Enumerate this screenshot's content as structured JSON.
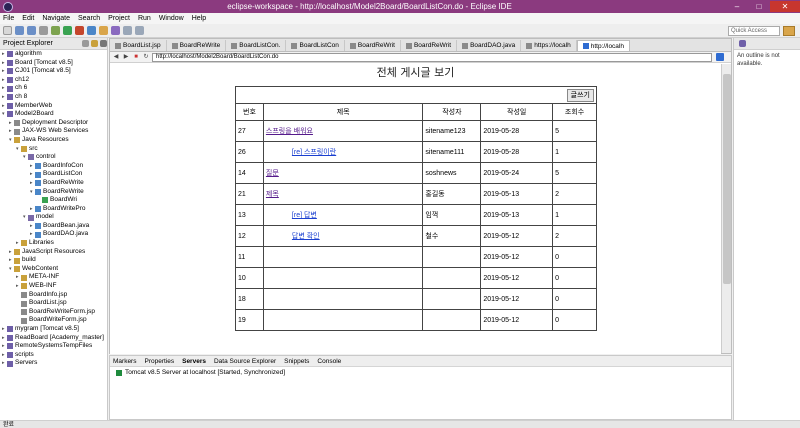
{
  "window": {
    "title": "eclipse-workspace - http://localhost/Model2Board/BoardListCon.do - Eclipse IDE",
    "min": "–",
    "max": "□",
    "close": "✕"
  },
  "menu": [
    "File",
    "Edit",
    "Navigate",
    "Search",
    "Project",
    "Run",
    "Window",
    "Help"
  ],
  "toolbar": {
    "quick_access": "Quick Access"
  },
  "explorer": {
    "title": "Project Explorer",
    "items": [
      {
        "label": "algorithm",
        "level": 0,
        "arrow": "▸",
        "color": "#6e5fa8"
      },
      {
        "label": "Board [Tomcat v8.5]",
        "level": 0,
        "arrow": "▸",
        "color": "#6e5fa8"
      },
      {
        "label": "CJ01 [Tomcat v8.5]",
        "level": 0,
        "arrow": "▸",
        "color": "#6e5fa8"
      },
      {
        "label": "ch12",
        "level": 0,
        "arrow": "▸",
        "color": "#6e5fa8"
      },
      {
        "label": "ch 6",
        "level": 0,
        "arrow": "▸",
        "color": "#6e5fa8"
      },
      {
        "label": "ch 8",
        "level": 0,
        "arrow": "▸",
        "color": "#6e5fa8"
      },
      {
        "label": "MemberWeb",
        "level": 0,
        "arrow": "▸",
        "color": "#6e5fa8"
      },
      {
        "label": "Model2Board",
        "level": 0,
        "arrow": "▾",
        "color": "#6e5fa8"
      },
      {
        "label": "Deployment Descriptor",
        "level": 1,
        "arrow": "▸",
        "color": "#8a8a8a"
      },
      {
        "label": "JAX-WS Web Services",
        "level": 1,
        "arrow": "▸",
        "color": "#8a8a8a"
      },
      {
        "label": "Java Resources",
        "level": 1,
        "arrow": "▾",
        "color": "#c9a13b"
      },
      {
        "label": "src",
        "level": 2,
        "arrow": "▾",
        "color": "#c9a13b"
      },
      {
        "label": "control",
        "level": 3,
        "arrow": "▾",
        "color": "#7a6aa8"
      },
      {
        "label": "BoardInfoCon",
        "level": 4,
        "arrow": "▸",
        "color": "#4a86c8"
      },
      {
        "label": "BoardListCon",
        "level": 4,
        "arrow": "▸",
        "color": "#4a86c8"
      },
      {
        "label": "BoardReWrite",
        "level": 4,
        "arrow": "▸",
        "color": "#4a86c8"
      },
      {
        "label": "BoardReWrite",
        "level": 4,
        "arrow": "▾",
        "color": "#4a86c8"
      },
      {
        "label": "BoardWri",
        "level": 5,
        "arrow": "",
        "color": "#3aa352"
      },
      {
        "label": "BoardWritePro",
        "level": 4,
        "arrow": "▸",
        "color": "#4a86c8"
      },
      {
        "label": "model",
        "level": 3,
        "arrow": "▾",
        "color": "#7a6aa8"
      },
      {
        "label": "BoardBean.java",
        "level": 4,
        "arrow": "▸",
        "color": "#4a86c8"
      },
      {
        "label": "BoardDAO.java",
        "level": 4,
        "arrow": "▸",
        "color": "#4a86c8"
      },
      {
        "label": "Libraries",
        "level": 2,
        "arrow": "▸",
        "color": "#c9a13b"
      },
      {
        "label": "JavaScript Resources",
        "level": 1,
        "arrow": "▸",
        "color": "#c9a13b"
      },
      {
        "label": "build",
        "level": 1,
        "arrow": "▸",
        "color": "#c9a13b"
      },
      {
        "label": "WebContent",
        "level": 1,
        "arrow": "▾",
        "color": "#c9a13b"
      },
      {
        "label": "META-INF",
        "level": 2,
        "arrow": "▸",
        "color": "#c9a13b"
      },
      {
        "label": "WEB-INF",
        "level": 2,
        "arrow": "▸",
        "color": "#c9a13b"
      },
      {
        "label": "BoardInfo.jsp",
        "level": 2,
        "arrow": "",
        "color": "#8a8a8a"
      },
      {
        "label": "BoardList.jsp",
        "level": 2,
        "arrow": "",
        "color": "#8a8a8a"
      },
      {
        "label": "BoardReWriteForm.jsp",
        "level": 2,
        "arrow": "",
        "color": "#8a8a8a"
      },
      {
        "label": "BoardWriteForm.jsp",
        "level": 2,
        "arrow": "",
        "color": "#8a8a8a"
      },
      {
        "label": "mygram [Tomcat v8.5]",
        "level": 0,
        "arrow": "▸",
        "color": "#6e5fa8"
      },
      {
        "label": "ReadBoard [Academy_master]",
        "level": 0,
        "arrow": "▸",
        "color": "#6e5fa8"
      },
      {
        "label": "RemoteSystemsTempFiles",
        "level": 0,
        "arrow": "▸",
        "color": "#6e5fa8"
      },
      {
        "label": "scripts",
        "level": 0,
        "arrow": "▸",
        "color": "#6e5fa8"
      },
      {
        "label": "Servers",
        "level": 0,
        "arrow": "▸",
        "color": "#6e5fa8"
      }
    ]
  },
  "editor": {
    "tabs": [
      {
        "label": "BoardList.jsp",
        "active": false
      },
      {
        "label": "BoardReWrite",
        "active": false
      },
      {
        "label": "BoardListCon.",
        "active": false
      },
      {
        "label": "BoardListCon",
        "active": false
      },
      {
        "label": "BoardReWrit",
        "active": false
      },
      {
        "label": "BoardReWrit",
        "active": false
      },
      {
        "label": "BoardDAO.java",
        "active": false
      },
      {
        "label": "https://localh",
        "active": false
      },
      {
        "label": "http://localh",
        "active": true
      }
    ],
    "url": "http://localhost/Model2Board/BoardListCon.do"
  },
  "board": {
    "title": "전체 게시글 보기",
    "write_label": "글쓰기",
    "headers": [
      "번호",
      "제목",
      "작성자",
      "작성일",
      "조회수"
    ],
    "rows": [
      {
        "num": "27",
        "title": "스프링을 배워요",
        "indent": 0,
        "reply": false,
        "writer": "sitename123",
        "date": "2019-05-28",
        "views": "5"
      },
      {
        "num": "26",
        "title": "[re] 스프링이란",
        "indent": 1,
        "reply": true,
        "writer": "sitename111",
        "date": "2019-05-28",
        "views": "1"
      },
      {
        "num": "14",
        "title": "질문",
        "indent": 0,
        "reply": false,
        "writer": "soshnews",
        "date": "2019-05-24",
        "views": "5"
      },
      {
        "num": "21",
        "title": "제목",
        "indent": 0,
        "reply": false,
        "writer": "홍길동",
        "date": "2019-05-13",
        "views": "2"
      },
      {
        "num": "13",
        "title": "[re] 답변",
        "indent": 1,
        "reply": true,
        "writer": "임꺽",
        "date": "2019-05-13",
        "views": "1"
      },
      {
        "num": "12",
        "title": "답변 확인",
        "indent": 1,
        "reply": true,
        "writer": "철수",
        "date": "2019-05-12",
        "views": "2"
      },
      {
        "num": "11",
        "title": "",
        "indent": 0,
        "reply": false,
        "writer": "",
        "date": "2019-05-12",
        "views": "0"
      },
      {
        "num": "10",
        "title": "",
        "indent": 0,
        "reply": false,
        "writer": "",
        "date": "2019-05-12",
        "views": "0"
      },
      {
        "num": "18",
        "title": "",
        "indent": 0,
        "reply": false,
        "writer": "",
        "date": "2019-05-12",
        "views": "0"
      },
      {
        "num": "19",
        "title": "",
        "indent": 0,
        "reply": false,
        "writer": "",
        "date": "2019-05-12",
        "views": "0"
      }
    ]
  },
  "outline": {
    "message": "An outline is not available."
  },
  "bottom": {
    "tabs": [
      "Markers",
      "Properties",
      "Servers",
      "Data Source Explorer",
      "Snippets",
      "Console"
    ],
    "active_tab": "Servers",
    "server_row": "Tomcat v8.5 Server at localhost  [Started, Synchronized]"
  },
  "statusbar": {
    "text": "완료"
  }
}
